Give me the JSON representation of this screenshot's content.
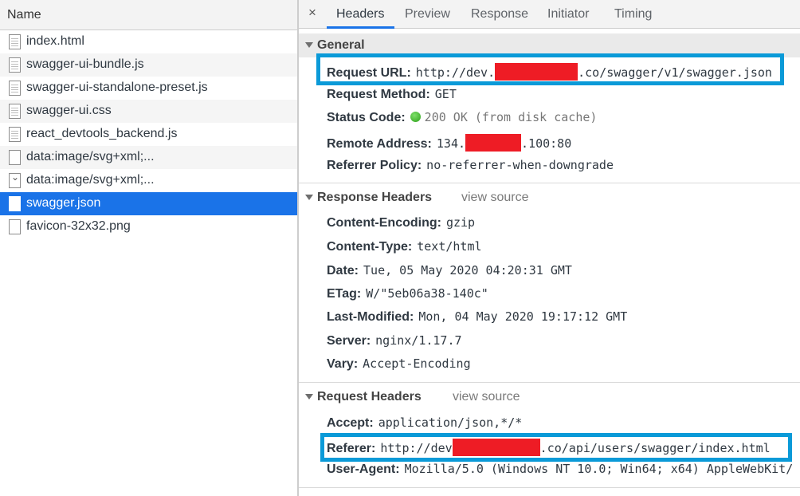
{
  "left_panel": {
    "header": "Name",
    "files": [
      {
        "name": "index.html",
        "icon": "document-icon"
      },
      {
        "name": "swagger-ui-bundle.js",
        "icon": "document-icon"
      },
      {
        "name": "swagger-ui-standalone-preset.js",
        "icon": "document-icon"
      },
      {
        "name": "swagger-ui.css",
        "icon": "document-icon"
      },
      {
        "name": "react_devtools_backend.js",
        "icon": "document-icon"
      },
      {
        "name": "data:image/svg+xml;...",
        "icon": "blank-file-icon"
      },
      {
        "name": "data:image/svg+xml;...",
        "icon": "chevron-file-icon"
      },
      {
        "name": "swagger.json",
        "icon": "blank-file-icon",
        "selected": true
      },
      {
        "name": "favicon-32x32.png",
        "icon": "blank-file-icon"
      }
    ]
  },
  "tabs": {
    "close": "×",
    "items": [
      "Headers",
      "Preview",
      "Response",
      "Initiator",
      "Timing"
    ],
    "active": "Headers"
  },
  "general": {
    "title": "General",
    "request_url_label": "Request URL:",
    "request_url_prefix": "http://dev.",
    "request_url_suffix": ".co/swagger/v1/swagger.json",
    "request_method_label": "Request Method:",
    "request_method": "GET",
    "status_code_label": "Status Code:",
    "status_code": "200 OK (from disk cache)",
    "remote_address_label": "Remote Address:",
    "remote_address_prefix": "134.",
    "remote_address_suffix": ".100:80",
    "referrer_policy_label": "Referrer Policy:",
    "referrer_policy": "no-referrer-when-downgrade"
  },
  "response_headers": {
    "title": "Response Headers",
    "view_source": "view source",
    "items": [
      {
        "key": "Content-Encoding:",
        "value": "gzip"
      },
      {
        "key": "Content-Type:",
        "value": "text/html"
      },
      {
        "key": "Date:",
        "value": "Tue, 05 May 2020 04:20:31 GMT"
      },
      {
        "key": "ETag:",
        "value": "W/\"5eb06a38-140c\""
      },
      {
        "key": "Last-Modified:",
        "value": "Mon, 04 May 2020 19:17:12 GMT"
      },
      {
        "key": "Server:",
        "value": "nginx/1.17.7"
      },
      {
        "key": "Vary:",
        "value": "Accept-Encoding"
      }
    ]
  },
  "request_headers": {
    "title": "Request Headers",
    "view_source": "view source",
    "accept_label": "Accept:",
    "accept": "application/json,*/*",
    "referer_label": "Referer:",
    "referer_prefix": "http://dev",
    "referer_suffix": ".co/api/users/swagger/index.html",
    "user_agent_label": "User-Agent:",
    "user_agent": "Mozilla/5.0 (Windows NT 10.0; Win64; x64) AppleWebKit/"
  },
  "colors": {
    "selected_row": "#1a73e8",
    "highlight_box": "#0a9ad8",
    "redaction": "#ee1c25",
    "status_ok": "#2d9f1a"
  }
}
